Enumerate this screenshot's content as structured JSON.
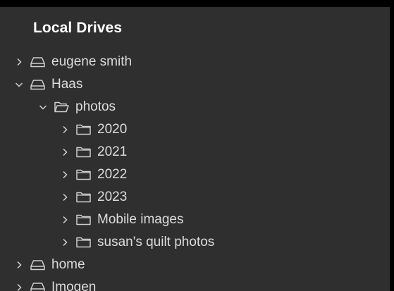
{
  "panel": {
    "title": "Local Drives"
  },
  "tree": {
    "eugene_smith": {
      "label": "eugene smith",
      "expanded": false,
      "icon": "drive-icon"
    },
    "haas": {
      "label": "Haas",
      "expanded": true,
      "icon": "drive-icon"
    },
    "photos": {
      "label": "photos",
      "expanded": true,
      "icon": "open-folder-icon"
    },
    "folder_2020": {
      "label": "2020",
      "expanded": false,
      "icon": "folder-icon"
    },
    "folder_2021": {
      "label": "2021",
      "expanded": false,
      "icon": "folder-icon"
    },
    "folder_2022": {
      "label": "2022",
      "expanded": false,
      "icon": "folder-icon"
    },
    "folder_2023": {
      "label": "2023",
      "expanded": false,
      "icon": "folder-icon"
    },
    "mobile_images": {
      "label": "Mobile images",
      "expanded": false,
      "icon": "folder-icon"
    },
    "susans_quilt_photos": {
      "label": "susan's quilt photos",
      "expanded": false,
      "icon": "folder-icon"
    },
    "home": {
      "label": "home",
      "expanded": false,
      "icon": "drive-icon"
    },
    "imogen": {
      "label": "Imogen",
      "expanded": false,
      "icon": "drive-icon"
    }
  },
  "colors": {
    "panel_background": "#2f2f2f",
    "title_text": "#ffffff",
    "item_text": "#dcdcdc",
    "icon_stroke": "#cfcfcf"
  }
}
